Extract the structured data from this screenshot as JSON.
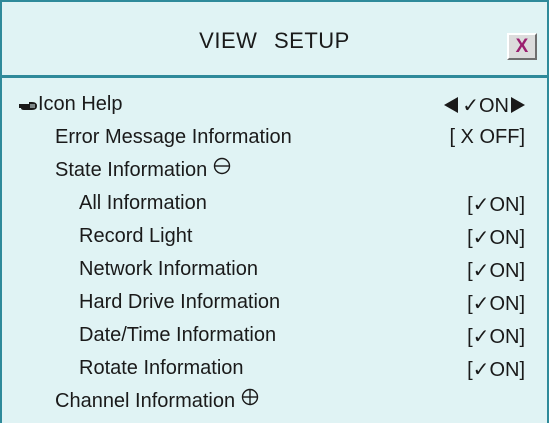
{
  "window": {
    "title": "VIEW   SETUP",
    "close_label": "X"
  },
  "icons": {
    "pointer": "pointing-hand-icon",
    "close": "close-icon",
    "collapse": "circle-minus-icon",
    "expand": "circle-plus-icon",
    "prev": "triangle-left-icon",
    "next": "triangle-right-icon"
  },
  "colors": {
    "background": "#e0f3f4",
    "border": "#2f8a9a",
    "close_x": "#9b1f6f"
  },
  "menu": {
    "icon_help": {
      "label": "Icon Help",
      "value": "✓ON"
    },
    "error_message": {
      "label": "Error Message Information",
      "value": "[ X OFF]"
    },
    "state_info": {
      "label": "State Information"
    },
    "all_info": {
      "label": "All Information",
      "value": "[✓ON]"
    },
    "record_light": {
      "label": "Record Light",
      "value": "[✓ON]"
    },
    "network_info": {
      "label": "Network Information",
      "value": "[✓ON]"
    },
    "hard_drive_info": {
      "label": "Hard Drive Information",
      "value": "[✓ON]"
    },
    "date_time_info": {
      "label": "Date/Time Information",
      "value": "[✓ON]"
    },
    "rotate_info": {
      "label": "Rotate Information",
      "value": "[✓ON]"
    },
    "channel_info": {
      "label": "Channel Information"
    }
  }
}
